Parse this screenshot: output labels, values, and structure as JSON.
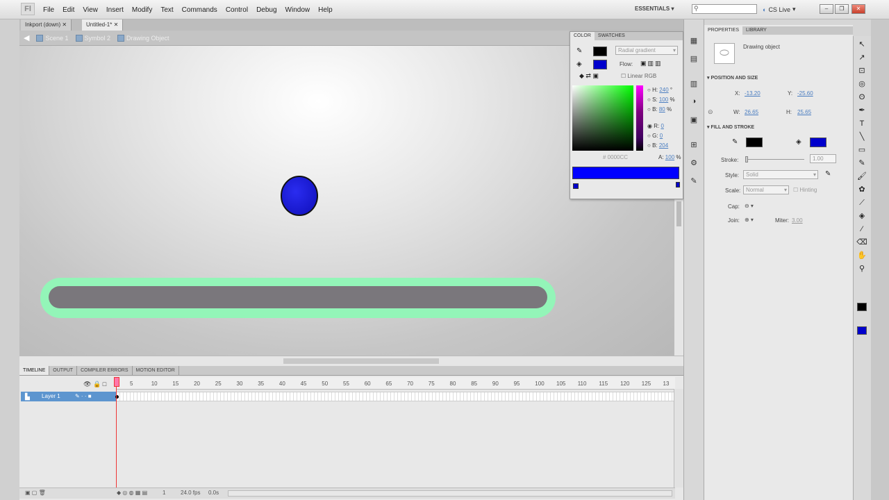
{
  "menu": [
    "File",
    "Edit",
    "View",
    "Insert",
    "Modify",
    "Text",
    "Commands",
    "Control",
    "Debug",
    "Window",
    "Help"
  ],
  "app": {
    "logo": "Fl",
    "workspace": "ESSENTIALS",
    "cslive": "CS Live",
    "search_placeholder": ""
  },
  "doc_tabs": [
    "Inkport (down)",
    "Untitled-1*"
  ],
  "breadcrumb": [
    "Scene 1",
    "Symbol 2",
    "Drawing Object"
  ],
  "timeline": {
    "tabs": [
      "TIMELINE",
      "OUTPUT",
      "COMPILER ERRORS",
      "MOTION EDITOR"
    ],
    "layer_name": "Layer 1",
    "ruler": [
      "1",
      "5",
      "10",
      "15",
      "20",
      "25",
      "30",
      "35",
      "40",
      "45",
      "50",
      "55",
      "60",
      "65",
      "70",
      "75",
      "80",
      "85",
      "90",
      "95",
      "100",
      "105",
      "110",
      "115",
      "120",
      "125",
      "13"
    ],
    "status_frame": "1",
    "fps": "24.0 fps",
    "time": "0.0s"
  },
  "color_panel": {
    "tabs": [
      "COLOR",
      "SWATCHES"
    ],
    "type": "Radial gradient",
    "flow_label": "Flow:",
    "linear_rgb": "Linear RGB",
    "hsb": [
      {
        "label": "H:",
        "value": "240",
        "unit": "°"
      },
      {
        "label": "S:",
        "value": "100",
        "unit": "%"
      },
      {
        "label": "B:",
        "value": "80",
        "unit": "%"
      }
    ],
    "rgb": [
      {
        "label": "R:",
        "value": "0"
      },
      {
        "label": "G:",
        "value": "0"
      },
      {
        "label": "B:",
        "value": "204"
      }
    ],
    "alpha": {
      "label": "A:",
      "value": "100",
      "unit": "%"
    },
    "hex": "0000CC",
    "stroke_color": "#000000",
    "fill_color": "#0000cc"
  },
  "properties": {
    "tabs": [
      "PROPERTIES",
      "LIBRARY"
    ],
    "object_type": "Drawing object",
    "pos_title": "POSITION AND SIZE",
    "x_label": "X:",
    "x_value": "-13.20",
    "y_label": "Y:",
    "y_value": "-25.60",
    "w_label": "W:",
    "w_value": "26.65",
    "h_label": "H:",
    "h_value": "25.65",
    "fill_title": "FILL AND STROKE",
    "stroke_label": "Stroke:",
    "stroke_value": "1.00",
    "style_label": "Style:",
    "style_value": "Solid",
    "scale_label": "Scale:",
    "scale_value": "Normal",
    "hinting": "Hinting",
    "cap_label": "Cap:",
    "join_label": "Join:",
    "miter_label": "Miter:",
    "miter_value": "3.00",
    "stroke_color": "#000000",
    "fill_color": "#0000cc"
  }
}
